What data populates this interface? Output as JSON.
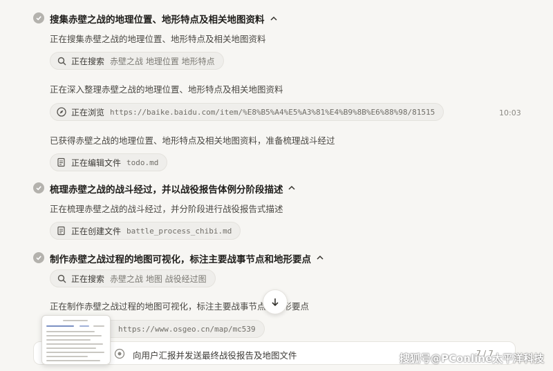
{
  "steps": [
    {
      "title": "搜集赤壁之战的地理位置、地形特点及相关地图资料",
      "entries": [
        {
          "desc": "正在搜集赤壁之战的地理位置、地形特点及相关地图资料"
        },
        {
          "tool": {
            "icon": "search-icon",
            "verb": "正在搜索",
            "arg": "赤壁之战 地理位置 地形特点"
          }
        },
        {
          "desc": "正在深入整理赤壁之战的地理位置、地形特点及相关地图资料"
        },
        {
          "tool": {
            "icon": "compass-icon",
            "verb": "正在浏览",
            "arg": "https://baike.baidu.com/item/%E8%B5%A4%E5%A3%81%E4%B9%8B%E6%88%98/81515"
          },
          "time": "10:03"
        },
        {
          "desc": "已获得赤壁之战的地理位置、地形特点及相关地图资料，准备梳理战斗经过"
        },
        {
          "tool": {
            "icon": "edit-file-icon",
            "verb": "正在编辑文件",
            "arg": "todo.md"
          }
        }
      ]
    },
    {
      "title": "梳理赤壁之战的战斗经过，并以战役报告体例分阶段描述",
      "entries": [
        {
          "desc": "正在梳理赤壁之战的战斗经过，并分阶段进行战役报告式描述"
        },
        {
          "tool": {
            "icon": "edit-file-icon",
            "verb": "正在创建文件",
            "arg": "battle_process_chibi.md"
          }
        }
      ]
    },
    {
      "title": "制作赤壁之战过程的地图可视化，标注主要战事节点和地形要点",
      "entries": [
        {
          "tool": {
            "icon": "search-icon",
            "verb": "正在搜索",
            "arg": "赤壁之战 地图 战役经过图"
          }
        },
        {
          "desc": "正在制作赤壁之战过程的地图可视化，标注主要战事节点和地形要点"
        },
        {
          "tool": {
            "icon": "compass-icon",
            "verb": "",
            "arg": "https://www.osgeo.cn/map/mc539"
          }
        }
      ]
    }
  ],
  "bottom_bar": {
    "label": "向用户汇报并发送最终战役报告及地图文件",
    "count": "7 / 7"
  },
  "watermark": "搜狐号@PConline太平洋科技",
  "colors": {
    "background": "#f7f6f3",
    "check": "#b4b2ad",
    "pill": "#efeeeb"
  }
}
